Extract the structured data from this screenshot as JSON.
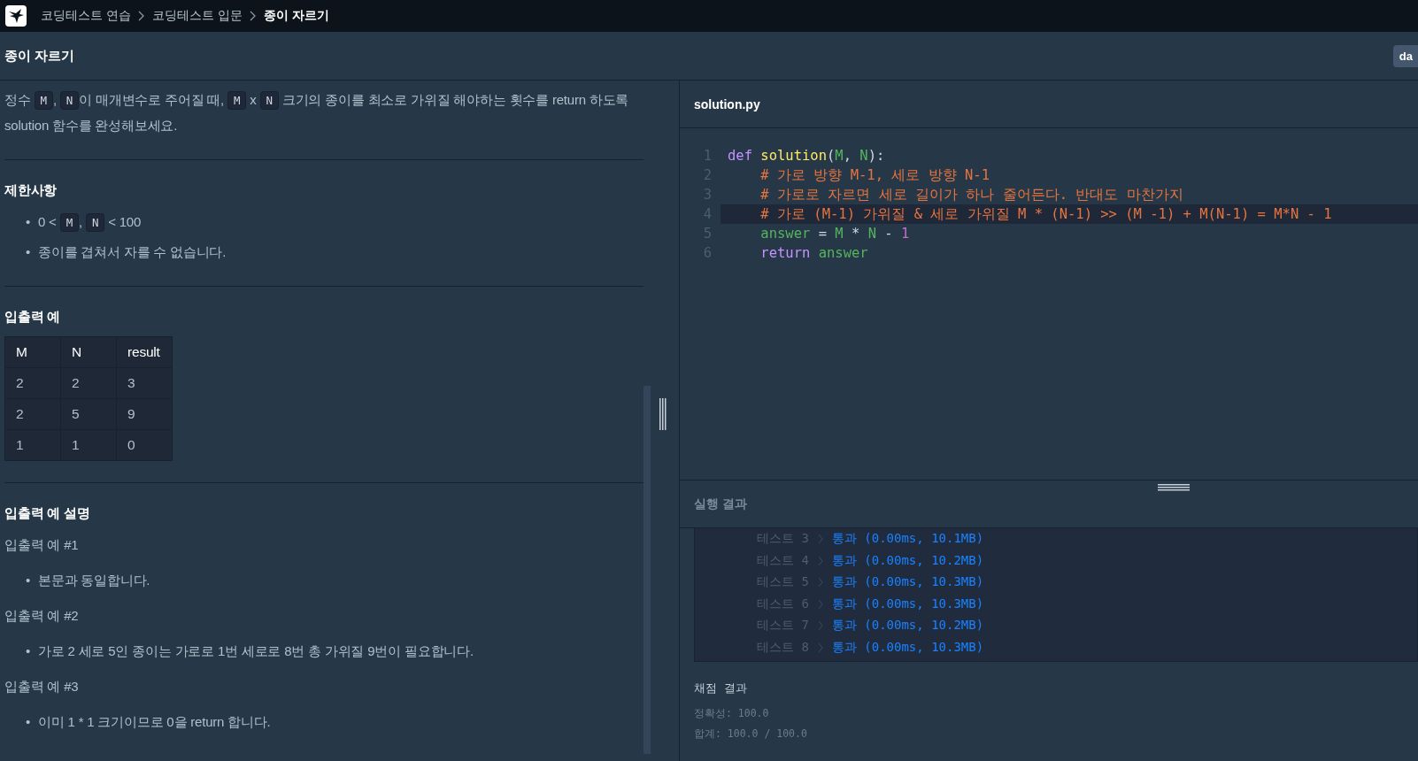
{
  "breadcrumb": [
    {
      "label": "코딩테스트 연습",
      "current": false
    },
    {
      "label": "코딩테스트 입문",
      "current": false
    },
    {
      "label": "종이 자르기",
      "current": true
    }
  ],
  "title": "종이 자르기",
  "title_button": "da",
  "blocks": [
    {
      "kind": "paragraph",
      "segments": [
        {
          "kind": "text",
          "text": "정수 "
        },
        {
          "kind": "code",
          "text": "M"
        },
        {
          "kind": "text",
          "text": ", "
        },
        {
          "kind": "code",
          "text": "N"
        },
        {
          "kind": "text",
          "text": "이 매개변수로 주어질 때, "
        },
        {
          "kind": "code",
          "text": "M"
        },
        {
          "kind": "text",
          "text": " x "
        },
        {
          "kind": "code",
          "text": "N"
        },
        {
          "kind": "text",
          "text": " 크기의 종이를 최소로 가위질 해야하는 횟수를 return 하도록 solution 함수를 완성해보세요."
        }
      ]
    },
    {
      "kind": "rule"
    },
    {
      "kind": "heading",
      "text": "제한사항"
    },
    {
      "kind": "list",
      "items": [
        {
          "marker": "•",
          "segments": [
            {
              "kind": "text",
              "text": "0 < "
            },
            {
              "kind": "code",
              "text": "M"
            },
            {
              "kind": "text",
              "text": ", "
            },
            {
              "kind": "code",
              "text": "N"
            },
            {
              "kind": "text",
              "text": " < 100"
            }
          ]
        },
        {
          "marker": "•",
          "segments": [
            {
              "kind": "text",
              "text": "종이를 겹쳐서 자를 수 없습니다."
            }
          ]
        }
      ]
    },
    {
      "kind": "rule"
    },
    {
      "kind": "heading",
      "text": "입출력 예"
    },
    {
      "kind": "table",
      "columns": [
        "M",
        "N",
        "result"
      ],
      "rows": [
        [
          "2",
          "2",
          "3"
        ],
        [
          "2",
          "5",
          "9"
        ],
        [
          "1",
          "1",
          "0"
        ]
      ]
    },
    {
      "kind": "rule"
    },
    {
      "kind": "heading",
      "text": "입출력 예 설명"
    },
    {
      "kind": "paragraph",
      "segments": [
        {
          "kind": "text",
          "text": "입출력 예 #1"
        }
      ]
    },
    {
      "kind": "list",
      "items": [
        {
          "marker": "•",
          "segments": [
            {
              "kind": "text",
              "text": "본문과 동일합니다."
            }
          ]
        }
      ]
    },
    {
      "kind": "paragraph",
      "segments": [
        {
          "kind": "text",
          "text": "입출력 예 #2"
        }
      ]
    },
    {
      "kind": "list",
      "items": [
        {
          "marker": "•",
          "segments": [
            {
              "kind": "text",
              "text": "가로 2 세로 5인 종이는 가로로 1번 세로로 8번 총 가위질 9번이 필요합니다."
            }
          ]
        }
      ]
    },
    {
      "kind": "paragraph",
      "segments": [
        {
          "kind": "text",
          "text": "입출력 예 #3"
        }
      ]
    },
    {
      "kind": "list",
      "items": [
        {
          "marker": "•",
          "segments": [
            {
              "kind": "text",
              "text": "이미 1 * 1 크기이므로 0을 return 합니다."
            }
          ]
        }
      ]
    }
  ],
  "editor": {
    "filename": "solution.py",
    "lines": [
      {
        "number": "1",
        "active": false,
        "tokens": [
          {
            "kind": "keyword",
            "text": "def"
          },
          {
            "kind": "function",
            "text": " solution"
          },
          {
            "kind": "plain",
            "text": "("
          },
          {
            "kind": "param",
            "text": "M"
          },
          {
            "kind": "plain",
            "text": ", "
          },
          {
            "kind": "param",
            "text": "N"
          },
          {
            "kind": "plain",
            "text": "):"
          }
        ]
      },
      {
        "number": "2",
        "active": false,
        "tokens": [
          {
            "kind": "comment",
            "text": "    # 가로 방향 M-1, 세로 방향 N-1"
          }
        ]
      },
      {
        "number": "3",
        "active": false,
        "tokens": [
          {
            "kind": "comment",
            "text": "    # 가로로 자르면 세로 길이가 하나 줄어든다. 반대도 마찬가지"
          }
        ]
      },
      {
        "number": "4",
        "active": true,
        "tokens": [
          {
            "kind": "comment",
            "text": "    # 가로 (M-1) 가위질 & 세로 가위질 M * (N-1) >> (M -1) + M(N-1) = M*N - 1"
          }
        ]
      },
      {
        "number": "5",
        "active": false,
        "tokens": [
          {
            "kind": "param",
            "text": "    answer"
          },
          {
            "kind": "plain",
            "text": " = "
          },
          {
            "kind": "param",
            "text": "M"
          },
          {
            "kind": "plain",
            "text": " * "
          },
          {
            "kind": "param",
            "text": "N"
          },
          {
            "kind": "plain",
            "text": " - "
          },
          {
            "kind": "number",
            "text": "1"
          }
        ]
      },
      {
        "number": "6",
        "active": false,
        "tokens": [
          {
            "kind": "keyword",
            "text": "    return"
          },
          {
            "kind": "param",
            "text": " answer"
          }
        ]
      }
    ]
  },
  "results": {
    "title": "실행 결과",
    "tests": [
      {
        "label": "테스트 3",
        "result": "통과 (0.00ms, 10.1MB)"
      },
      {
        "label": "테스트 4",
        "result": "통과 (0.00ms, 10.2MB)"
      },
      {
        "label": "테스트 5",
        "result": "통과 (0.00ms, 10.3MB)"
      },
      {
        "label": "테스트 6",
        "result": "통과 (0.00ms, 10.3MB)"
      },
      {
        "label": "테스트 7",
        "result": "통과 (0.00ms, 10.2MB)"
      },
      {
        "label": "테스트 8",
        "result": "통과 (0.00ms, 10.3MB)"
      }
    ],
    "scoring_title": "채점 결과",
    "scoring_lines": [
      "정확성: 100.0",
      "합계: 100.0 / 100.0"
    ]
  }
}
